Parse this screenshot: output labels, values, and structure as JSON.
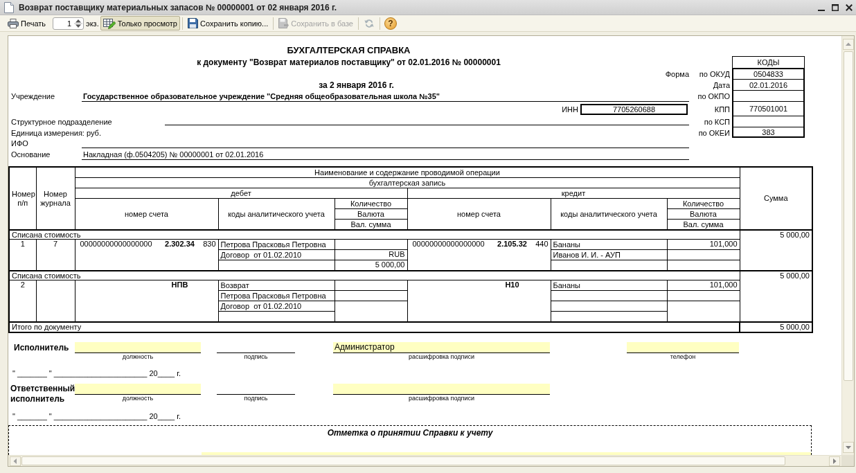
{
  "window": {
    "title": "Возврат поставщику материальных запасов № 00000001 от 02 января 2016 г."
  },
  "toolbar": {
    "groups": [
      [
        {
          "kind": "print",
          "label": "Печать",
          "disabled": false,
          "pressed": false
        },
        {
          "kind": "spin",
          "value": "1"
        },
        {
          "kind": "text",
          "label": "экз."
        },
        {
          "kind": "toggle",
          "label": "Только просмотр",
          "disabled": false,
          "pressed": true
        }
      ],
      [
        {
          "kind": "save",
          "label": "Сохранить копию...",
          "disabled": false,
          "pressed": false
        }
      ],
      [
        {
          "kind": "savebase",
          "label": "Сохранить в базе",
          "disabled": true,
          "pressed": false
        }
      ],
      [
        {
          "kind": "refresh",
          "disabled": true,
          "pressed": false
        }
      ],
      [
        {
          "kind": "help",
          "label": "?",
          "disabled": false,
          "pressed": false
        }
      ]
    ]
  },
  "document": {
    "title": "БУХГАЛТЕРСКАЯ СПРАВКА",
    "subtitle": "к документу \"Возврат материалов поставщику\" от 02.01.2016 № 00000001",
    "period": "за 2 января 2016 г.",
    "form_label": "Форма",
    "codes_header": "КОДЫ",
    "codes": [
      {
        "label": "по ОКУД",
        "value": "0504833"
      },
      {
        "label": "Дата",
        "value": "02.01.2016"
      },
      {
        "label": "по ОКПО"
      },
      {
        "label": "КПП",
        "value": "770501001"
      },
      {
        "label": "по КСП"
      },
      {
        "label": "по ОКЕИ",
        "value": "383"
      }
    ],
    "institution": {
      "label": "Учреждение",
      "value": "Государственное образовательное учреждение \"Средняя общеобразовательная школа №35\""
    },
    "inn": {
      "label": "ИНН",
      "value": "7705260688"
    },
    "subdivision": {
      "label": "Структурное подразделение"
    },
    "unit": {
      "label": "Единица измерения: руб."
    },
    "ifo": {
      "label": "ИФО"
    },
    "basis": {
      "label": "Основание",
      "value": "Накладная (ф.0504205) № 00000001 от 02.01.2016"
    }
  },
  "table": {
    "columns": {
      "number": "Номер п/п",
      "journal": "Номер журнала",
      "operation": "Наименование и содержание проводимой операции",
      "entry": "бухгалтерская запись",
      "sum": "Сумма",
      "sides": [
        {
          "title": "дебет",
          "account": "номер счета",
          "analytics": "коды аналитического учета",
          "amounts": [
            "Количество",
            "Валюта",
            "Вал. сумма"
          ]
        },
        {
          "title": "кредит",
          "account": "номер счета",
          "analytics": "коды аналитического учета",
          "amounts": [
            "Количество",
            "Валюта",
            "Вал. сумма"
          ]
        }
      ]
    },
    "groups": [
      {
        "operation": "Списана стоимость",
        "sum": "5 000,00",
        "number": "1",
        "journal": "7",
        "debit": {
          "account": {
            "prefix": "00000000000000000",
            "number": "2.302.34",
            "suffix": "830"
          },
          "analytics": [
            "Петрова Прасковья Петровна",
            "Договор  от 01.02.2010"
          ],
          "currency": "RUB",
          "currency_amount": "5 000,00"
        },
        "credit": {
          "account": {
            "prefix": "00000000000000000",
            "number": "2.105.32",
            "suffix": "440"
          },
          "analytics": [
            "Бананы",
            "Иванов И. И. - АУП"
          ],
          "quantity": "101,000"
        }
      },
      {
        "operation": "Списана стоимость",
        "sum": "5 000,00",
        "number": "2",
        "debit": {
          "account": {
            "number": "НПВ"
          },
          "analytics": [
            "Возврат",
            "Петрова Прасковья Петровна",
            "Договор  от 01.02.2010"
          ]
        },
        "credit": {
          "account": {
            "number": "Н10"
          },
          "analytics": [
            "Бананы"
          ],
          "quantity": "101,000"
        }
      }
    ],
    "total": {
      "label": "Итого по документу",
      "sum": "5 000,00"
    }
  },
  "signatures": [
    {
      "role": "Исполнитель",
      "fields": [
        {
          "kind": "input",
          "caption": "должность"
        },
        {
          "kind": "line",
          "caption": "подпись"
        },
        {
          "kind": "input",
          "caption": "расшифровка подписи",
          "value": "Администратор"
        },
        {
          "kind": "input",
          "caption": "телефон"
        }
      ],
      "date": "\" _______ \" ______________________ 20____ г."
    },
    {
      "role": "Ответственный исполнитель",
      "fields": [
        {
          "kind": "input",
          "caption": "должность"
        },
        {
          "kind": "line",
          "caption": "подпись"
        },
        {
          "kind": "input",
          "caption": "расшифровка подписи"
        }
      ],
      "date": "\" _______ \" ______________________ 20____ г."
    }
  ],
  "acceptance": {
    "title": "Отметка о принятии Справки к учету"
  }
}
